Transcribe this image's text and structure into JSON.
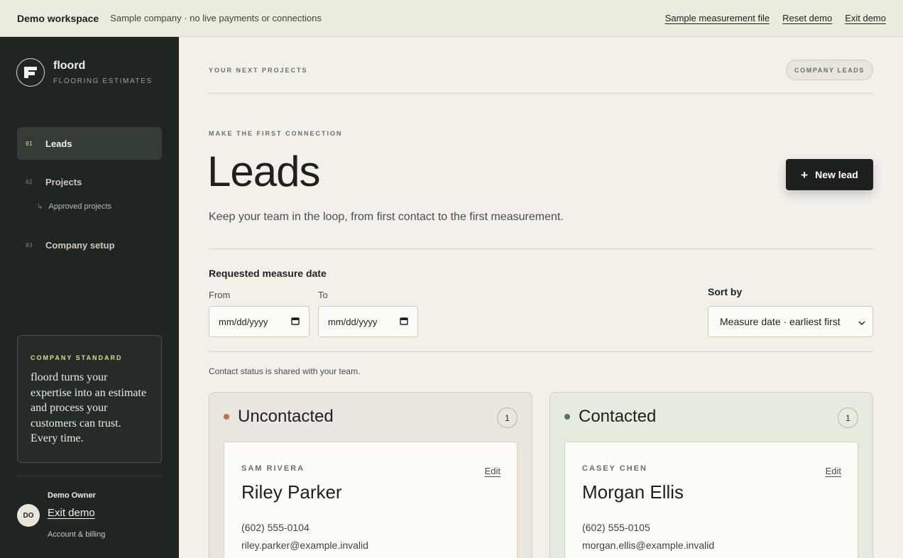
{
  "banner": {
    "workspace": "Demo workspace",
    "subtitle": "Sample company · no live payments or connections",
    "links": [
      "Sample measurement file",
      "Reset demo",
      "Exit demo"
    ]
  },
  "sidebar": {
    "brand": {
      "name": "floord",
      "tagline": "FLOORING ESTIMATES"
    },
    "nav": [
      {
        "num": "01",
        "label": "Leads",
        "active": true
      },
      {
        "num": "02",
        "label": "Projects",
        "active": false
      },
      {
        "num": "03",
        "label": "Company setup",
        "active": false
      }
    ],
    "subnav": {
      "label": "Approved projects"
    },
    "standard": {
      "kicker": "COMPANY STANDARD",
      "quote": "floord turns your expertise into an estimate and process your customers can trust. Every time."
    },
    "account": {
      "initials": "DO",
      "name": "Demo Owner",
      "exit": "Exit demo",
      "billing": "Account & billing"
    }
  },
  "main": {
    "eyebrow_top": "YOUR NEXT PROJECTS",
    "pill": "COMPANY LEADS",
    "eyebrow": "MAKE THE FIRST CONNECTION",
    "title": "Leads",
    "description": "Keep your team in the loop, from first contact to the first measurement.",
    "new_lead_label": "New lead",
    "filters": {
      "title": "Requested measure date",
      "from_label": "From",
      "to_label": "To",
      "from_value": "mm/dd/yyyy",
      "to_value": "mm/dd/yyyy",
      "sort_label": "Sort by",
      "sort_value": "Measure date · earliest first"
    },
    "shared_note": "Contact status is shared with your team.",
    "columns": [
      {
        "title": "Uncontacted",
        "count": "1",
        "dot_color": "#c0704e",
        "card": {
          "contact": "SAM RIVERA",
          "name": "Riley Parker",
          "phone": "(602) 555-0104",
          "email": "riley.parker@example.invalid",
          "edit": "Edit"
        }
      },
      {
        "title": "Contacted",
        "count": "1",
        "dot_color": "#4f7a4c",
        "card": {
          "contact": "CASEY CHEN",
          "name": "Morgan Ellis",
          "phone": "(602) 555-0105",
          "email": "morgan.ellis@example.invalid",
          "edit": "Edit"
        }
      }
    ]
  },
  "colors": {
    "sidebar_bg": "#1f2622",
    "accent": "#cfe08a",
    "page_bg": "#f3f0ea",
    "button_bg": "#1d211d"
  }
}
